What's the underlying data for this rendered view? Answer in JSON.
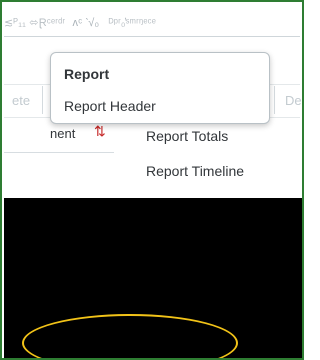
{
  "breadcrumb": {
    "segments": [
      "≲ᴾ₁₁ ⬄Ɽᶜᵉʳᵈʳ",
      "ʌᶜ ‵√₀",
      "ᴰᵖʳ₀̓ˢᵐʳᵑᵉᶜᵉ"
    ]
  },
  "action_bar": {
    "left_label": "ete",
    "right_label": "Del"
  },
  "column": {
    "header_text": "nent",
    "sort_icon": "⇅"
  },
  "menu": {
    "title": "Report",
    "items": [
      {
        "label": "Report Header"
      }
    ],
    "submenu": [
      {
        "label": "Report Totals"
      },
      {
        "label": "Report Timeline"
      }
    ]
  },
  "colors": {
    "frame_border": "#2e7d32",
    "sort_icon": "#c62828",
    "annotation": "#f2c318",
    "overlay": "#000000"
  }
}
